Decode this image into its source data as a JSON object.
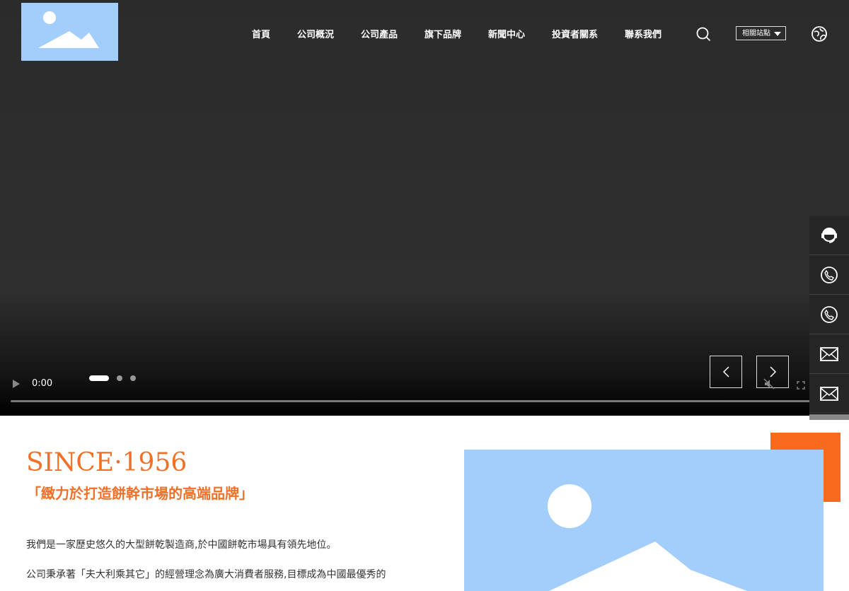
{
  "header": {
    "logo_label": "logo",
    "nav": [
      "首頁",
      "公司概況",
      "公司產品",
      "旗下品牌",
      "新聞中心",
      "投資者關系",
      "聯系我們"
    ],
    "related_sites": "相關站點"
  },
  "video": {
    "time": "0:00",
    "slides_total": 3,
    "slide_active": 1
  },
  "sidebar": {
    "items": [
      "service-icon",
      "phone-icon",
      "phone-icon",
      "mail-icon",
      "mail-icon"
    ]
  },
  "content": {
    "since": "SINCE·1956",
    "slogan": "「緻力於打造餅幹市場的高端品牌」",
    "paragraph_1": "我們是一家歷史悠久的大型餅乾製造商,於中國餅乾市場具有領先地位。",
    "paragraph_2": "公司秉承著「夫大利乘其它」的經營理念為廣大消費者服務,目標成為中國最優秀的"
  },
  "colors": {
    "accent": "#f07028",
    "orange_block": "#f86b1c",
    "placeholder_blue": "#a3cdfa",
    "sidebar": "#262626"
  }
}
